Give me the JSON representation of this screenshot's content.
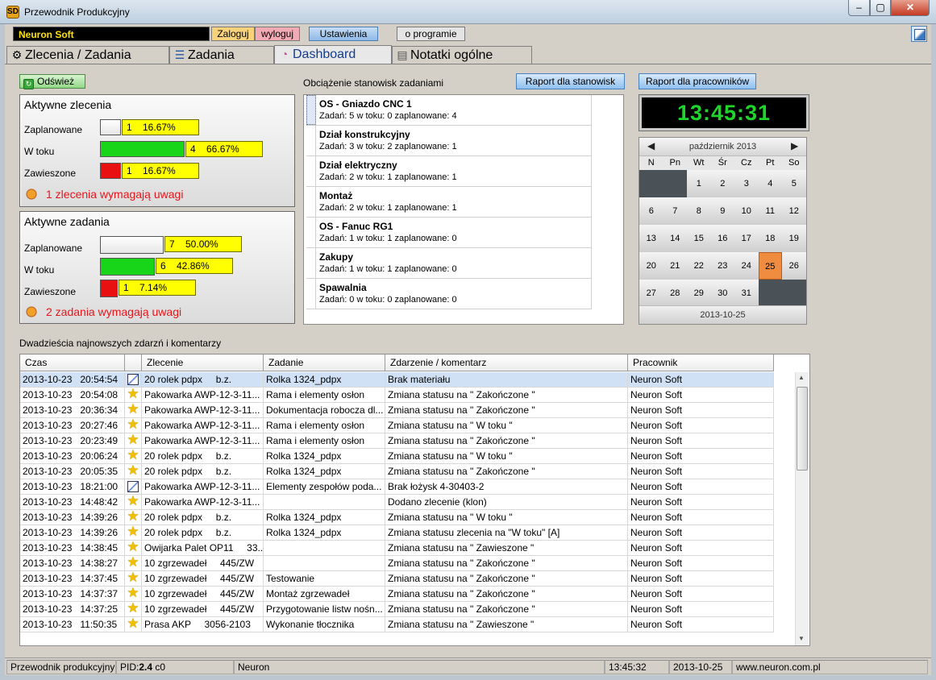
{
  "window": {
    "title": "Przewodnik Produkcyjny",
    "app_icon": "SD",
    "minimize": "–",
    "maximize": "▢",
    "close": "✕"
  },
  "toolbar": {
    "brand": "Neuron Soft",
    "login": "Zaloguj",
    "logout": "wyloguj",
    "settings": "Ustawienia",
    "about": "o programie"
  },
  "tabs": [
    {
      "label": "Zlecenia / Zadania",
      "icon": "gear-icon"
    },
    {
      "label": "Zadania",
      "icon": "tasks-icon"
    },
    {
      "label": "Dashboard",
      "icon": "pie-chart-icon"
    },
    {
      "label": "Notatki ogólne",
      "icon": "notes-icon"
    }
  ],
  "refresh": {
    "label": "Odśwież"
  },
  "active_orders": {
    "title": "Aktywne zlecenia",
    "rows": [
      {
        "label": "Zaplanowane",
        "text": "1    16.67%",
        "fraction": 0.1667,
        "color": "#eeeeee"
      },
      {
        "label": "W toku",
        "text": "4    66.67%",
        "fraction": 0.6667,
        "color": "#19d519"
      },
      {
        "label": "Zawieszone",
        "text": "1    16.67%",
        "fraction": 0.1667,
        "color": "#e81010"
      }
    ],
    "warning": "1 zlecenia wymagają uwagi"
  },
  "active_tasks": {
    "title": "Aktywne zadania",
    "rows": [
      {
        "label": "Zaplanowane",
        "text": "7    50.00%",
        "fraction": 0.5,
        "color": "#eeeeee"
      },
      {
        "label": "W toku",
        "text": "6    42.86%",
        "fraction": 0.4286,
        "color": "#19d519"
      },
      {
        "label": "Zawieszone",
        "text": "1    7.14%",
        "fraction": 0.0714,
        "color": "#e81010"
      }
    ],
    "warning": "2 zadania wymagają uwagi"
  },
  "workstations": {
    "title": "Obciążenie stanowisk zadaniami",
    "report_button": "Raport dla stanowisk",
    "items": [
      {
        "name": "OS - Gniazdo CNC 1",
        "info": "Zadań: 5    w toku: 0  zaplanowane: 4"
      },
      {
        "name": "Dział konstrukcyjny",
        "info": "Zadań: 3    w toku: 2  zaplanowane: 1"
      },
      {
        "name": "Dział elektryczny",
        "info": "Zadań: 2    w toku: 1  zaplanowane: 1"
      },
      {
        "name": "Montaż",
        "info": "Zadań: 2    w toku: 1  zaplanowane: 1"
      },
      {
        "name": "OS - Fanuc RG1",
        "info": "Zadań: 1    w toku: 1  zaplanowane: 0"
      },
      {
        "name": "Zakupy",
        "info": "Zadań: 1    w toku: 1  zaplanowane: 0"
      },
      {
        "name": "Spawalnia",
        "info": "Zadań: 0    w toku: 0  zaplanowane: 0"
      }
    ]
  },
  "workers_report_button": "Raport dla pracowników",
  "clock": "13:45:31",
  "calendar": {
    "month": "październik 2013",
    "prev": "◀",
    "next": "▶",
    "dow": [
      "N",
      "Pn",
      "Wt",
      "Śr",
      "Cz",
      "Pt",
      "So"
    ],
    "weeks": [
      [
        "",
        "",
        "1",
        "2",
        "3",
        "4",
        "5"
      ],
      [
        "6",
        "7",
        "8",
        "9",
        "10",
        "11",
        "12"
      ],
      [
        "13",
        "14",
        "15",
        "16",
        "17",
        "18",
        "19"
      ],
      [
        "20",
        "21",
        "22",
        "23",
        "24",
        "25",
        "26"
      ],
      [
        "27",
        "28",
        "29",
        "30",
        "31",
        "",
        ""
      ]
    ],
    "today": "25",
    "footer": "2013-10-25"
  },
  "events": {
    "title": "Dwadzieścia najnowszych zdarzń i komentarzy",
    "columns": [
      "Czas",
      "",
      "Zlecenie",
      "Zadanie",
      "Zdarzenie / komentarz",
      "Pracownik"
    ],
    "rows": [
      {
        "time": "2013-10-23   20:54:54",
        "icon": "note-icon",
        "order": "20 rolek pdpx     b.z.",
        "task": "Rolka 1324_pdpx",
        "event": "Brak materiału",
        "worker": "Neuron Soft"
      },
      {
        "time": "2013-10-23   20:54:08",
        "icon": "star-icon",
        "order": "Pakowarka AWP-12-3-11...",
        "task": "Rama i elementy osłon",
        "event": "Zmiana statusu na \" Zakończone \"",
        "worker": "Neuron Soft"
      },
      {
        "time": "2013-10-23   20:36:34",
        "icon": "star-icon",
        "order": "Pakowarka AWP-12-3-11...",
        "task": "Dokumentacja robocza dl...",
        "event": "Zmiana statusu na \" Zakończone \"",
        "worker": "Neuron Soft"
      },
      {
        "time": "2013-10-23   20:27:46",
        "icon": "star-icon",
        "order": "Pakowarka AWP-12-3-11...",
        "task": "Rama i elementy osłon",
        "event": "Zmiana statusu na \" W toku \"",
        "worker": "Neuron Soft"
      },
      {
        "time": "2013-10-23   20:23:49",
        "icon": "star-icon",
        "order": "Pakowarka AWP-12-3-11...",
        "task": "Rama i elementy osłon",
        "event": "Zmiana statusu na \" Zakończone \"",
        "worker": "Neuron Soft"
      },
      {
        "time": "2013-10-23   20:06:24",
        "icon": "star-icon",
        "order": "20 rolek pdpx     b.z.",
        "task": "Rolka 1324_pdpx",
        "event": "Zmiana statusu na \" W toku \"",
        "worker": "Neuron Soft"
      },
      {
        "time": "2013-10-23   20:05:35",
        "icon": "star-icon",
        "order": "20 rolek pdpx     b.z.",
        "task": "Rolka 1324_pdpx",
        "event": "Zmiana statusu na \" Zakończone \"",
        "worker": "Neuron Soft"
      },
      {
        "time": "2013-10-23   18:21:00",
        "icon": "note-icon",
        "order": "Pakowarka AWP-12-3-11...",
        "task": "Elementy zespołów poda...",
        "event": "Brak łożysk 4-30403-2",
        "worker": "Neuron Soft"
      },
      {
        "time": "2013-10-23   14:48:42",
        "icon": "star-icon",
        "order": "Pakowarka AWP-12-3-11...",
        "task": "",
        "event": "Dodano zlecenie (klon)",
        "worker": "Neuron Soft"
      },
      {
        "time": "2013-10-23   14:39:26",
        "icon": "star-icon",
        "order": "20 rolek pdpx     b.z.",
        "task": "Rolka 1324_pdpx",
        "event": "Zmiana statusu na \" W toku \"",
        "worker": "Neuron Soft"
      },
      {
        "time": "2013-10-23   14:39:26",
        "icon": "star-icon",
        "order": "20 rolek pdpx     b.z.",
        "task": "Rolka 1324_pdpx",
        "event": "Zmiana statusu zlecenia na \"W toku\" [A]",
        "worker": "Neuron Soft"
      },
      {
        "time": "2013-10-23   14:38:45",
        "icon": "star-icon",
        "order": "Owijarka Palet OP11     33...",
        "task": "",
        "event": "Zmiana statusu na \" Zawieszone \"",
        "worker": "Neuron Soft"
      },
      {
        "time": "2013-10-23   14:38:27",
        "icon": "star-icon",
        "order": "10 zgrzewadeł     445/ZW",
        "task": "",
        "event": "Zmiana statusu na \" Zakończone \"",
        "worker": "Neuron Soft"
      },
      {
        "time": "2013-10-23   14:37:45",
        "icon": "star-icon",
        "order": "10 zgrzewadeł     445/ZW",
        "task": "Testowanie",
        "event": "Zmiana statusu na \" Zakończone \"",
        "worker": "Neuron Soft"
      },
      {
        "time": "2013-10-23   14:37:37",
        "icon": "star-icon",
        "order": "10 zgrzewadeł     445/ZW",
        "task": "Montaż zgrzewadeł",
        "event": "Zmiana statusu na \" Zakończone \"",
        "worker": "Neuron Soft"
      },
      {
        "time": "2013-10-23   14:37:25",
        "icon": "star-icon",
        "order": "10 zgrzewadeł     445/ZW",
        "task": "Przygotowanie listw nośn...",
        "event": "Zmiana statusu na \" Zakończone \"",
        "worker": "Neuron Soft"
      },
      {
        "time": "2013-10-23   11:50:35",
        "icon": "star-icon",
        "order": "Prasa AKP     3056-2103",
        "task": "Wykonanie tłocznika",
        "event": "Zmiana statusu na \" Zawieszone \"",
        "worker": "Neuron Soft"
      }
    ]
  },
  "statusbar": {
    "app": "Przewodnik produkcyjny",
    "pid_label": "PID:",
    "pid_value": "2.4",
    "pid_suffix": " c0",
    "user": "Neuron",
    "time": "13:45:32",
    "date": "2013-10-25",
    "url": "www.neuron.com.pl"
  }
}
